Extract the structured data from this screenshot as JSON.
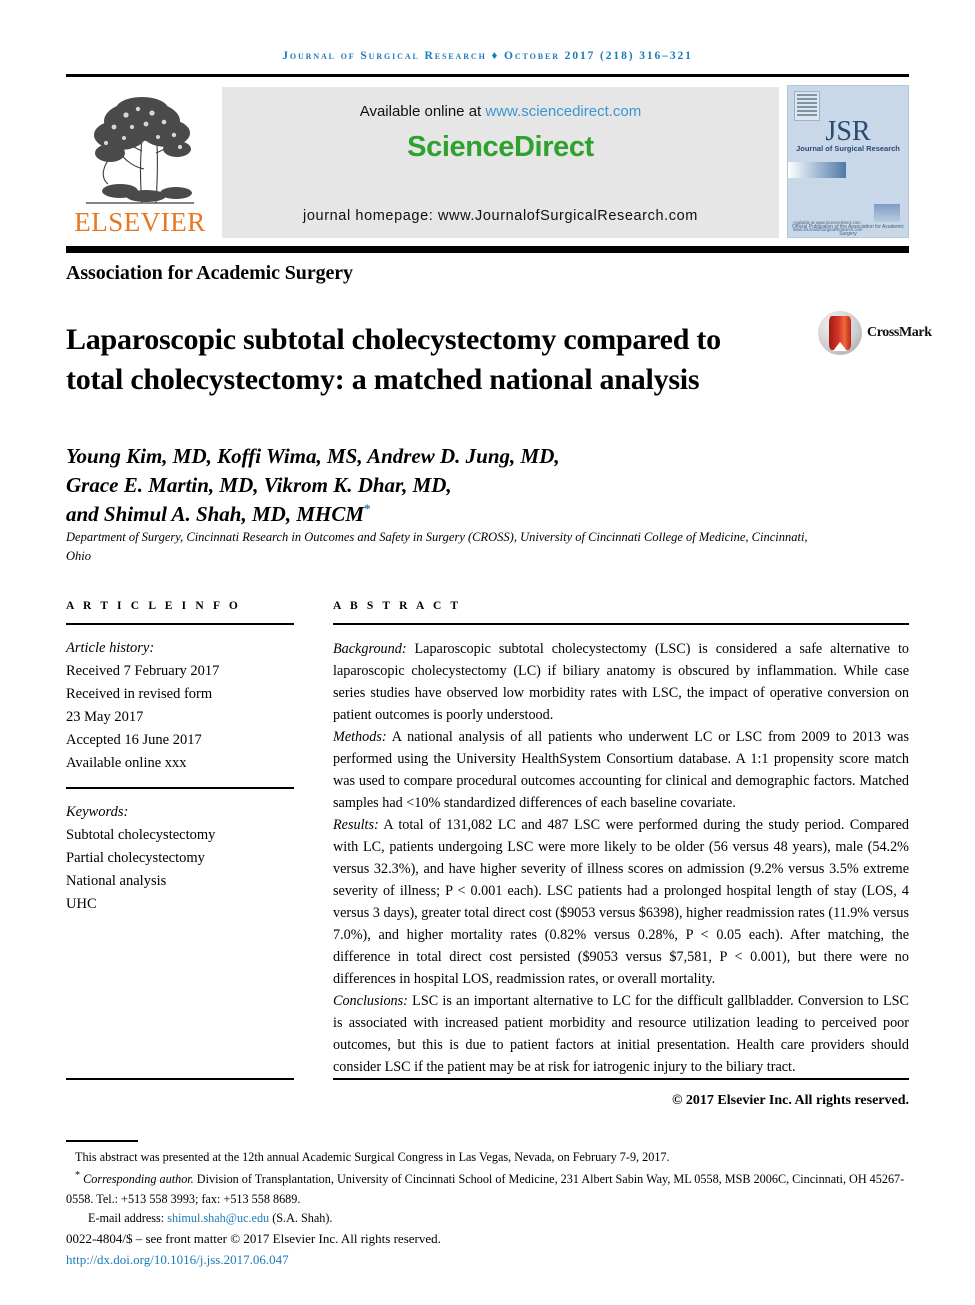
{
  "running_head": "Journal of Surgical Research ♦ October 2017 (218) 316–321",
  "masthead": {
    "publisher": "ELSEVIER",
    "available_prefix": "Available online at ",
    "available_url": "www.sciencedirect.com",
    "brand": "ScienceDirect",
    "homepage": "journal homepage: www.JournalofSurgicalResearch.com",
    "cover": {
      "title": "JSR",
      "subtitle": "Journal of Surgical Research",
      "association": "Official Publication of the Association for Academic Surgery",
      "footer": "Available at www.ScienceDirect.com  www.JournalofSurgicalResearch.com"
    }
  },
  "society": "Association for Academic Surgery",
  "title": "Laparoscopic subtotal cholecystectomy compared to total cholecystectomy: a matched national analysis",
  "crossmark_label": "CrossMark",
  "authors": "Young Kim, MD, Koffi Wima, MS, Andrew D. Jung, MD, Grace E. Martin, MD, Vikrom K. Dhar, MD, and Shimul A. Shah, MD, MHCM",
  "author_lines": [
    "Young Kim, MD, Koffi Wima, MS, Andrew D. Jung, MD,",
    "Grace E. Martin, MD, Vikrom K. Dhar, MD,",
    "and Shimul A. Shah, MD, MHCM"
  ],
  "corresponding_marker": "*",
  "affiliation": "Department of Surgery, Cincinnati Research in Outcomes and Safety in Surgery (CROSS), University of Cincinnati College of Medicine, Cincinnati, Ohio",
  "article_info": {
    "heading": "A R T I C L E   I N F O",
    "history_label": "Article history:",
    "history": [
      "Received 7 February 2017",
      "Received in revised form",
      "23 May 2017",
      "Accepted 16 June 2017",
      "Available online xxx"
    ],
    "keywords_label": "Keywords:",
    "keywords": [
      "Subtotal cholecystectomy",
      "Partial cholecystectomy",
      "National analysis",
      "UHC"
    ]
  },
  "abstract": {
    "heading": "A B S T R A C T",
    "background_label": "Background:",
    "background": " Laparoscopic subtotal cholecystectomy (LSC) is considered a safe alternative to laparoscopic cholecystectomy (LC) if biliary anatomy is obscured by inflammation. While case series studies have observed low morbidity rates with LSC, the impact of operative conversion on patient outcomes is poorly understood.",
    "methods_label": "Methods:",
    "methods": " A national analysis of all patients who underwent LC or LSC from 2009 to 2013 was performed using the University HealthSystem Consortium database. A 1:1 propensity score match was used to compare procedural outcomes accounting for clinical and demographic factors. Matched samples had <10% standardized differences of each baseline covariate.",
    "results_label": "Results:",
    "results": " A total of 131,082 LC and 487 LSC were performed during the study period. Compared with LC, patients undergoing LSC were more likely to be older (56 versus 48 years), male (54.2% versus 32.3%), and have higher severity of illness scores on admission (9.2% versus 3.5% extreme severity of illness; P < 0.001 each). LSC patients had a prolonged hospital length of stay (LOS, 4 versus 3 days), greater total direct cost ($9053 versus $6398), higher readmission rates (11.9% versus 7.0%), and higher mortality rates (0.82% versus 0.28%, P < 0.05 each). After matching, the difference in total direct cost persisted ($9053 versus $7,581, P < 0.001), but there were no differences in hospital LOS, readmission rates, or overall mortality.",
    "conclusions_label": "Conclusions:",
    "conclusions": " LSC is an important alternative to LC for the difficult gallbladder. Conversion to LSC is associated with increased patient morbidity and resource utilization leading to perceived poor outcomes, but this is due to patient factors at initial presentation. Health care providers should consider LSC if the patient may be at risk for iatrogenic injury to the biliary tract.",
    "copyright": "© 2017 Elsevier Inc. All rights reserved."
  },
  "footnotes": {
    "presented": "This abstract was presented at the 12th annual Academic Surgical Congress in Las Vegas, Nevada, on February 7-9, 2017.",
    "corresponding_marker": "*",
    "corresponding_lead": "Corresponding author.",
    "corresponding": " Division of Transplantation, University of Cincinnati School of Medicine, 231 Albert Sabin Way, ML 0558, MSB 2006C, Cincinnati, OH 45267-0558. Tel.: +513 558 3993; fax: +513 558 8689.",
    "email_label": "E-mail address: ",
    "email": "shimul.shah@uc.edu",
    "email_suffix": " (S.A. Shah).",
    "issn": "0022-4804/$ – see front matter © 2017 Elsevier Inc. All rights reserved.",
    "doi": "http://dx.doi.org/10.1016/j.jss.2017.06.047"
  },
  "colors": {
    "link": "#1A7BB9",
    "elsevier_orange": "#E87722",
    "sciencedirect_green": "#2EA12E",
    "sd_box_gray": "#E6E6E6",
    "cover_blue": "#C8D8E8",
    "crossmark_red": "#D8372A"
  }
}
